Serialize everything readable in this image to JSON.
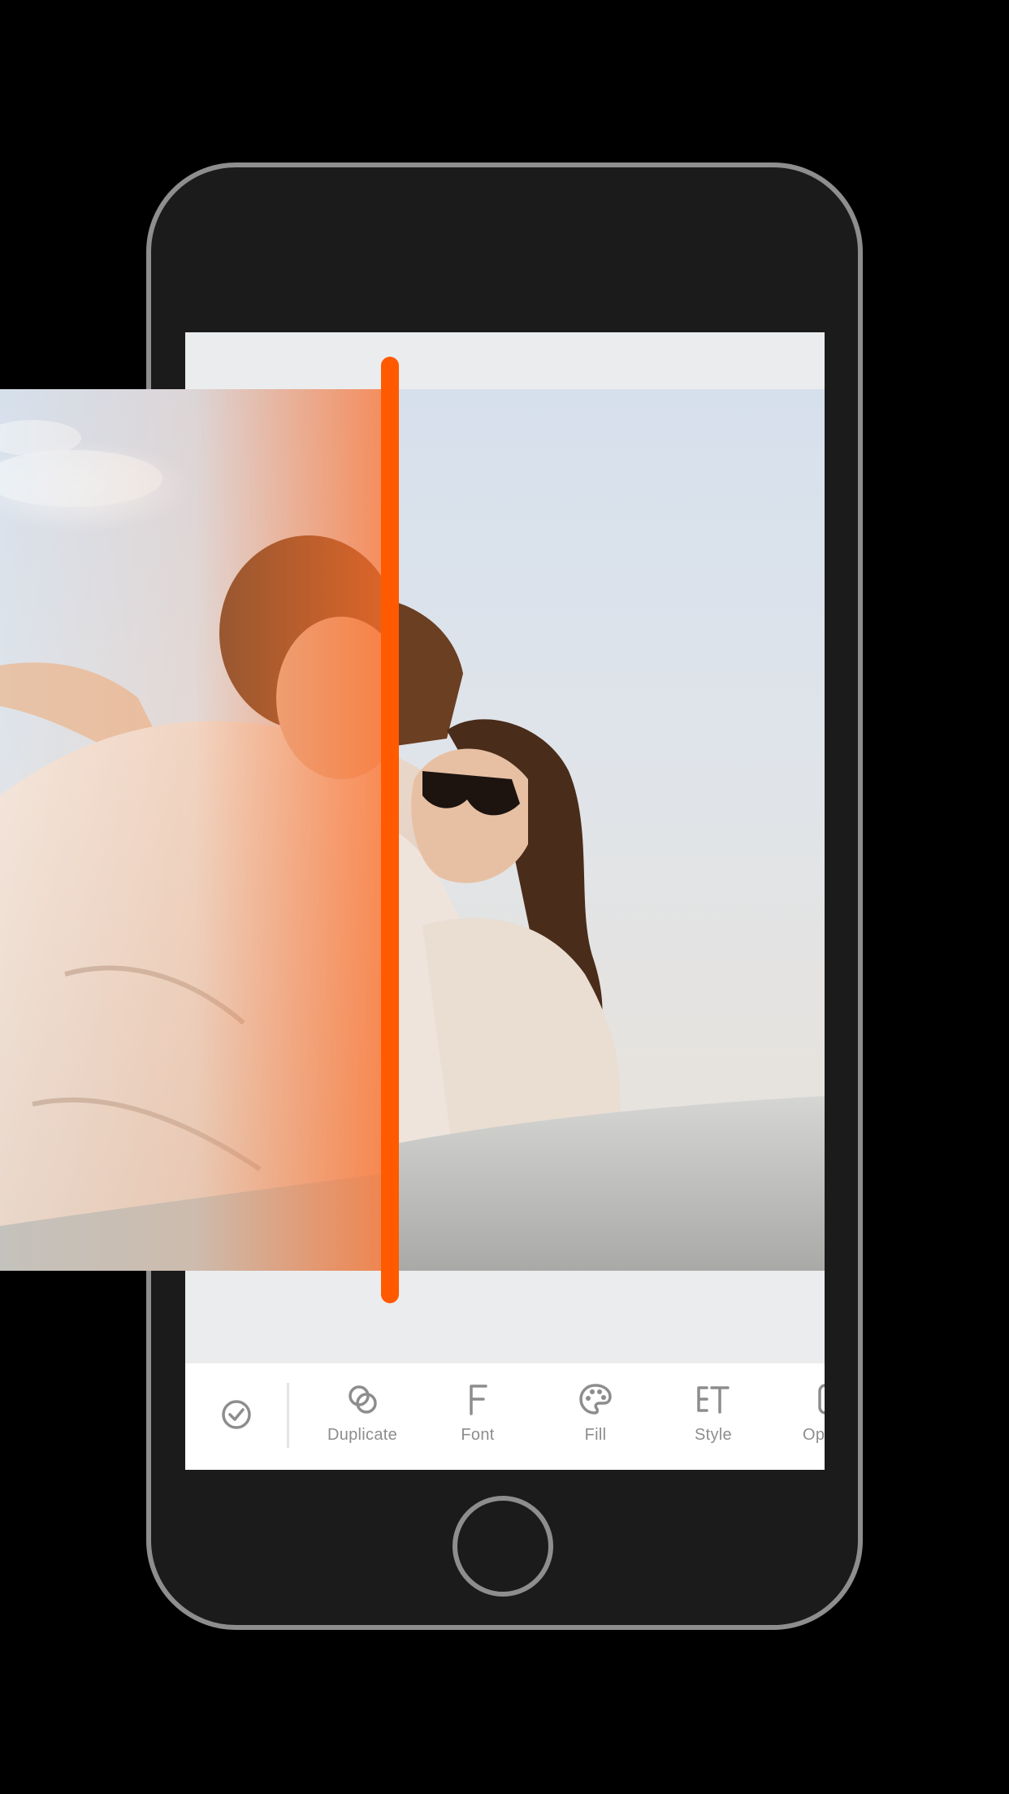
{
  "toolbar": {
    "items": [
      {
        "label": "Duplicate",
        "icon": "duplicate-icon"
      },
      {
        "label": "Font",
        "icon": "font-icon"
      },
      {
        "label": "Fill",
        "icon": "palette-icon"
      },
      {
        "label": "Style",
        "icon": "text-style-icon"
      },
      {
        "label": "Opa",
        "icon": "opacity-icon"
      }
    ],
    "confirm_icon": "check-circle-icon"
  },
  "colors": {
    "accent": "#ff5a00",
    "icon_gray": "#8d8d8d",
    "phone_frame": "#8e8e8e"
  }
}
